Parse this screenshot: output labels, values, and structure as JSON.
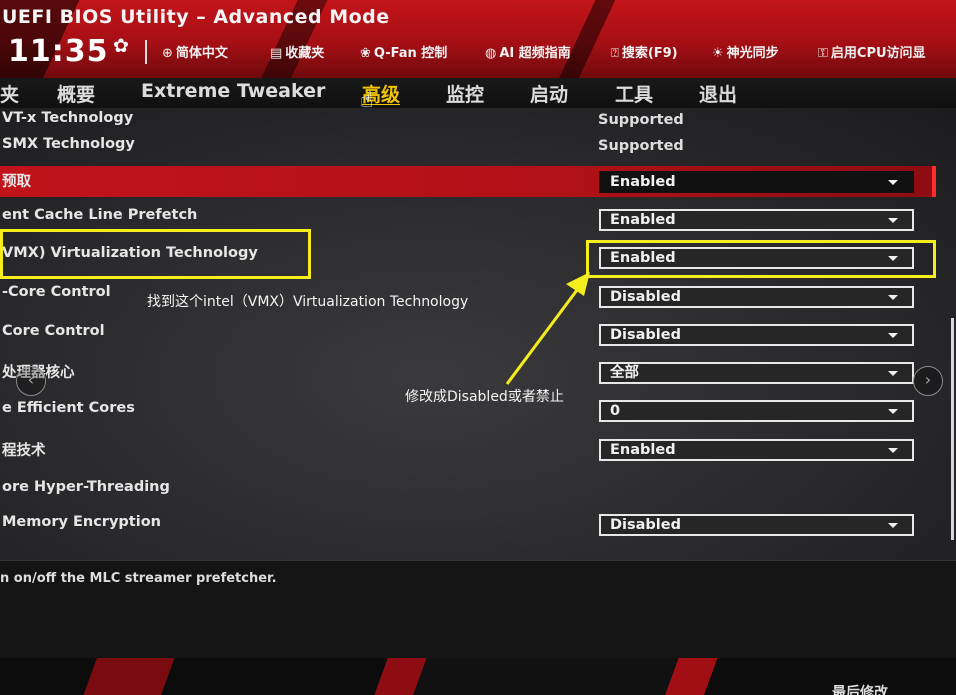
{
  "header": {
    "title": "UEFI BIOS Utility – Advanced Mode",
    "time": "11:35",
    "items": [
      {
        "icon": "globe-icon",
        "label": "简体中文"
      },
      {
        "icon": "bookmark-icon",
        "label": "收藏夹"
      },
      {
        "icon": "fan-icon",
        "label": "Q-Fan 控制"
      },
      {
        "icon": "ai-icon",
        "label": "AI 超频指南"
      },
      {
        "icon": "help-icon",
        "label": "搜索(F9)"
      },
      {
        "icon": "aura-icon",
        "label": "神光同步"
      },
      {
        "icon": "cpu-access-icon",
        "label": "启用CPU访问显"
      }
    ]
  },
  "tabs": [
    {
      "label": "夹"
    },
    {
      "label": "概要"
    },
    {
      "label": "Extreme Tweaker"
    },
    {
      "label": "高级",
      "active": true
    },
    {
      "label": "监控"
    },
    {
      "label": "启动"
    },
    {
      "label": "工具"
    },
    {
      "label": "退出"
    }
  ],
  "settings": [
    {
      "label": "VT-x Technology",
      "value": "Supported"
    },
    {
      "label": "SMX Technology",
      "value": "Supported"
    },
    {
      "label": "预取",
      "dropdown": "Enabled"
    },
    {
      "label": "ent Cache Line Prefetch",
      "dropdown": "Enabled"
    },
    {
      "label": "VMX) Virtualization Technology",
      "dropdown": "Enabled"
    },
    {
      "label": "-Core Control",
      "dropdown": "Disabled"
    },
    {
      "label": "Core Control",
      "dropdown": "Disabled"
    },
    {
      "label": "处理器核心",
      "dropdown": "全部"
    },
    {
      "label": "e Efficient Cores",
      "dropdown": "0"
    },
    {
      "label": "程技术",
      "dropdown": "Enabled"
    },
    {
      "label": "ore Hyper-Threading"
    },
    {
      "label": "Memory Encryption",
      "dropdown": "Disabled"
    }
  ],
  "annotations": {
    "find_note": "找到这个intel（VMX）Virtualization Technology",
    "change_note": "修改成Disabled或者禁止",
    "highlight_color": "#f5ee1c"
  },
  "help": {
    "text": "n on/off the MLC streamer prefetcher."
  },
  "footer": {
    "items": [
      "最后修改"
    ]
  },
  "colors": {
    "accent_red": "#c0131a",
    "active_tab": "#f0c400"
  }
}
